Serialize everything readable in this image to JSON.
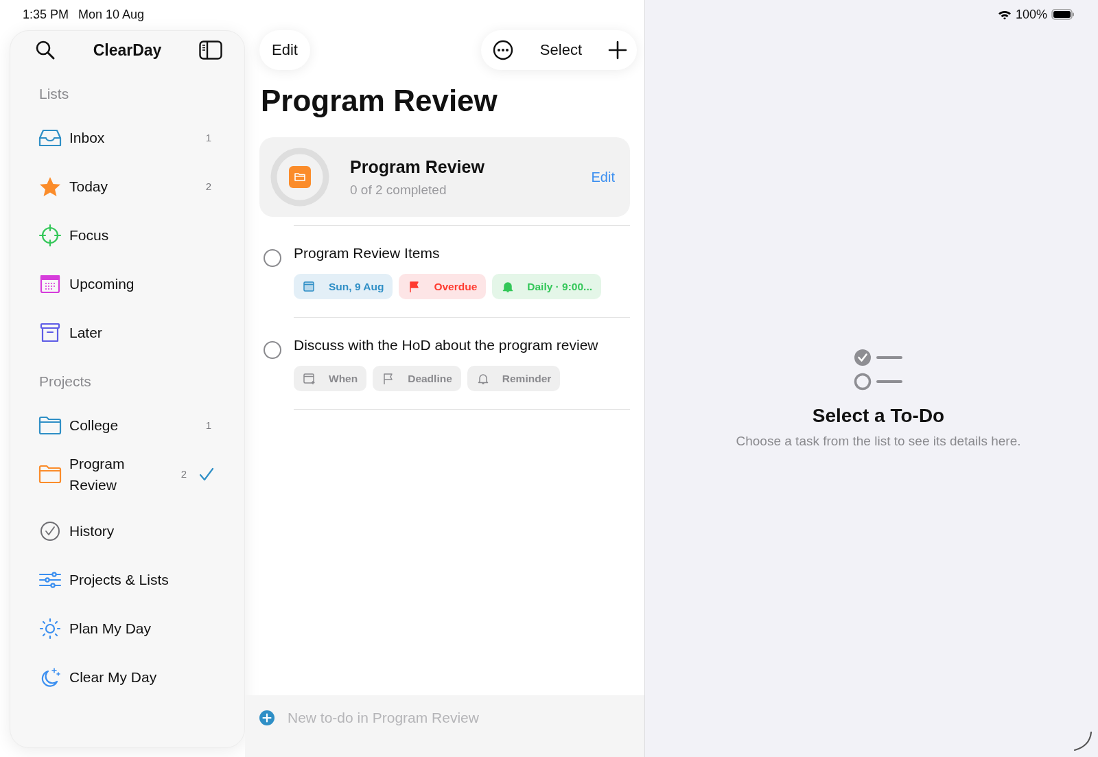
{
  "status_bar": {
    "time": "1:35 PM",
    "date": "Mon 10 Aug",
    "battery": "100%"
  },
  "sidebar": {
    "title": "ClearDay",
    "sections": [
      {
        "heading": "Lists",
        "items": [
          {
            "kind": "inbox",
            "label": "Inbox",
            "count": "1",
            "selected": false
          },
          {
            "kind": "star",
            "label": "Today",
            "count": "2",
            "selected": false
          },
          {
            "kind": "target",
            "label": "Focus",
            "selected": false
          },
          {
            "kind": "calendar",
            "label": "Upcoming",
            "selected": false
          },
          {
            "kind": "archive",
            "label": "Later",
            "selected": false
          }
        ]
      },
      {
        "heading": "Projects",
        "items": [
          {
            "kind": "folder",
            "label": "College",
            "count": "1",
            "selected": false
          },
          {
            "kind": "project",
            "label": "Program Review",
            "count": "2",
            "selected": true
          }
        ]
      }
    ],
    "extra_items": [
      {
        "kind": "history",
        "label": "History",
        "selected": false
      },
      {
        "kind": "sliders",
        "label": "Projects & Lists",
        "selected": false
      },
      {
        "kind": "sun",
        "label": "Plan My Day",
        "selected": false
      },
      {
        "kind": "moon",
        "label": "Clear My Day",
        "selected": false
      }
    ]
  },
  "toolbar": {
    "edit": "Edit",
    "select": "Select"
  },
  "title": "Program Review",
  "project_card": {
    "title": "Program Review",
    "subtitle": "0 of 2 completed",
    "level": 0,
    "edit": "Edit"
  },
  "tasks": [
    {
      "title": "Program Review Items",
      "checked": false,
      "chips": [
        {
          "kind": "date",
          "label": "Sun, 9 Aug",
          "set": true
        },
        {
          "kind": "deadline",
          "label": "Overdue",
          "set": true
        },
        {
          "kind": "reminder",
          "label": "Daily · 9:00...",
          "set": true
        }
      ]
    },
    {
      "title": "Discuss with the HoD about the program review",
      "checked": false,
      "chips": [
        {
          "kind": "date",
          "label": "When",
          "set": false
        },
        {
          "kind": "deadline",
          "label": "Deadline",
          "set": false
        },
        {
          "kind": "reminder",
          "label": "Reminder",
          "set": false
        }
      ]
    }
  ],
  "new_todo": {
    "placeholder": "New to-do in Program Review"
  },
  "detail": {
    "title": "Select a To-Do",
    "message": "Choose a task from the list to see its details here."
  }
}
